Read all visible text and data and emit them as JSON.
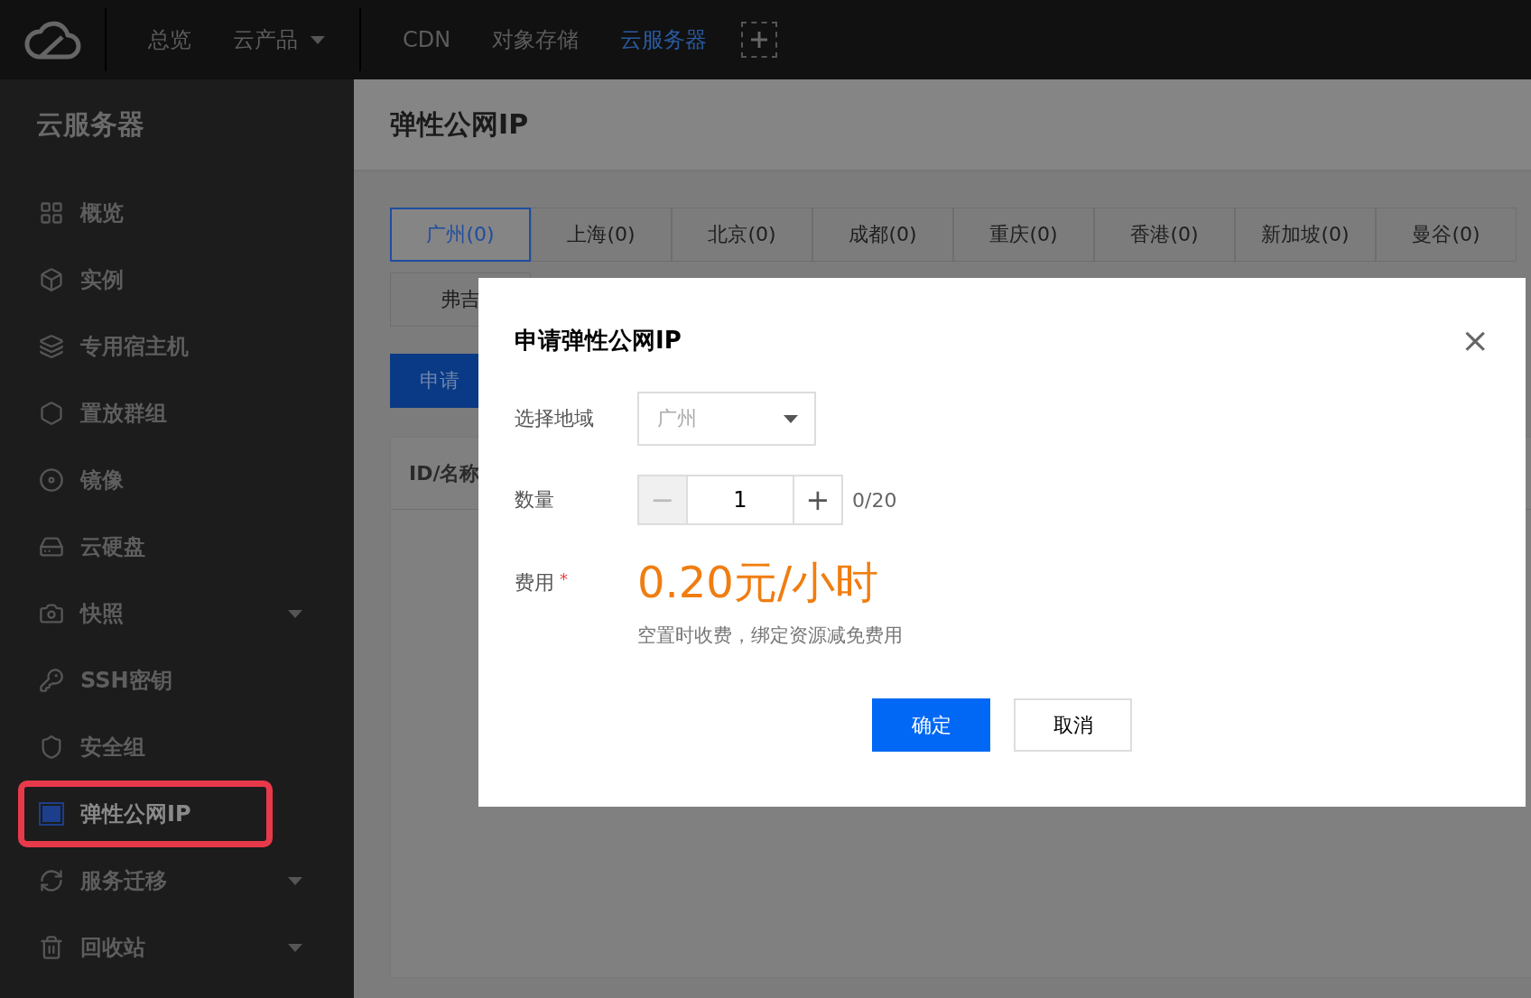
{
  "top_nav": {
    "groups": [
      [
        {
          "label": "总览",
          "selected": false,
          "dropdown": false
        },
        {
          "label": "云产品",
          "selected": false,
          "dropdown": true
        }
      ],
      [
        {
          "label": "CDN",
          "selected": false,
          "dropdown": false
        },
        {
          "label": "对象存储",
          "selected": false,
          "dropdown": false
        },
        {
          "label": "云服务器",
          "selected": true,
          "dropdown": false
        }
      ]
    ]
  },
  "sidebar": {
    "title": "云服务器",
    "items": [
      {
        "label": "概览",
        "selected": false,
        "expandable": false
      },
      {
        "label": "实例",
        "selected": false,
        "expandable": false
      },
      {
        "label": "专用宿主机",
        "selected": false,
        "expandable": false
      },
      {
        "label": "置放群组",
        "selected": false,
        "expandable": false
      },
      {
        "label": "镜像",
        "selected": false,
        "expandable": false
      },
      {
        "label": "云硬盘",
        "selected": false,
        "expandable": false
      },
      {
        "label": "快照",
        "selected": false,
        "expandable": true
      },
      {
        "label": "SSH密钥",
        "selected": false,
        "expandable": false
      },
      {
        "label": "安全组",
        "selected": false,
        "expandable": false
      },
      {
        "label": "弹性公网IP",
        "selected": true,
        "expandable": false
      },
      {
        "label": "服务迁移",
        "selected": false,
        "expandable": true
      },
      {
        "label": "回收站",
        "selected": false,
        "expandable": true
      }
    ]
  },
  "page": {
    "title": "弹性公网IP",
    "region_tab_rows": [
      [
        {
          "label": "广州(0)",
          "selected": true
        },
        {
          "label": "上海(0)",
          "selected": false
        },
        {
          "label": "北京(0)",
          "selected": false
        },
        {
          "label": "成都(0)",
          "selected": false
        },
        {
          "label": "重庆(0)",
          "selected": false
        },
        {
          "label": "香港(0)",
          "selected": false
        },
        {
          "label": "新加坡(0)",
          "selected": false
        },
        {
          "label": "曼谷(0)",
          "selected": false
        }
      ],
      [
        {
          "label": "弗吉",
          "selected": false
        }
      ]
    ],
    "apply_button": "申请",
    "table": {
      "columns": [
        "ID/名称"
      ]
    }
  },
  "dialog": {
    "title": "申请弹性公网IP",
    "close": "×",
    "region": {
      "label": "选择地域",
      "value": "广州"
    },
    "quantity": {
      "label": "数量",
      "minus": "−",
      "value": "1",
      "plus": "+",
      "minus_disabled": true,
      "limit": "0/20"
    },
    "fee": {
      "label": "费用",
      "required_mark": "*",
      "price": "0.20元/小时",
      "note": "空置时收费，绑定资源减免费用"
    },
    "buttons": [
      {
        "label": "确定",
        "kind": "primary"
      },
      {
        "label": "取消",
        "kind": "secondary"
      }
    ]
  }
}
